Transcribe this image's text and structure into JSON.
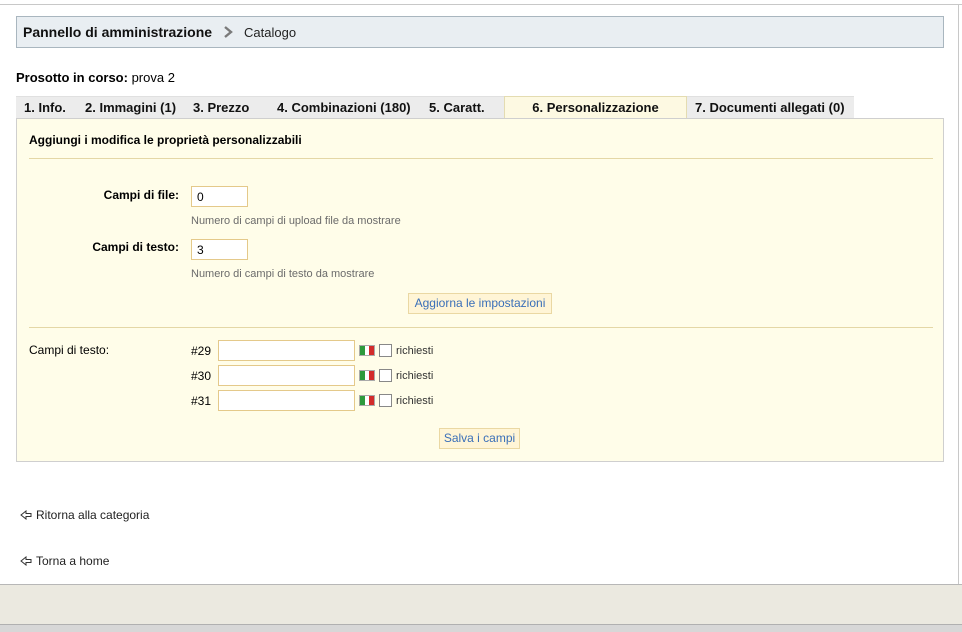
{
  "breadcrumb": {
    "root": "Pannello di amministrazione",
    "current": "Catalogo"
  },
  "product": {
    "label": "Prosotto in corso:",
    "name": "prova 2"
  },
  "tabs": [
    {
      "label": "1. Info."
    },
    {
      "label": "2. Immagini (1)"
    },
    {
      "label": "3. Prezzo"
    },
    {
      "label": "4. Combinazioni (180)"
    },
    {
      "label": "5. Caratt."
    },
    {
      "label": "6. Personalizzazione",
      "active": true
    },
    {
      "label": "7. Documenti allegati (0)"
    }
  ],
  "panel": {
    "title": "Aggiungi i modifica le proprietà personalizzabili",
    "file_fields": {
      "label": "Campi di file:",
      "value": "0",
      "hint": "Numero di campi di upload file da mostrare"
    },
    "text_fields": {
      "label": "Campi di testo:",
      "value": "3",
      "hint": "Numero di campi di testo da mostrare"
    },
    "update_button": "Aggiorna le impostazioni",
    "text_fields_section_label": "Campi di testo:",
    "rows": [
      {
        "num": "#29",
        "required_label": "richiesti"
      },
      {
        "num": "#30",
        "required_label": "richiesti"
      },
      {
        "num": "#31",
        "required_label": "richiesti"
      }
    ],
    "save_button": "Salva i campi"
  },
  "links": {
    "back_category": "Ritorna alla categoria",
    "home": "Torna a home"
  },
  "colors": {
    "panel_bg": "#fffde9",
    "link_blue": "#3a6fb8",
    "flag_green": "#2e9a3c",
    "flag_white": "#ffffff",
    "flag_red": "#d22b2b"
  }
}
